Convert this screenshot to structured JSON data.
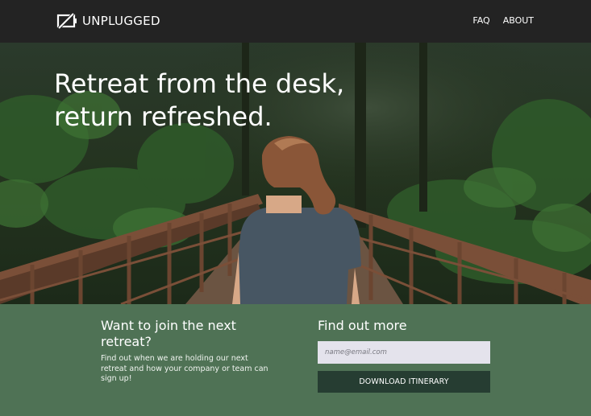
{
  "nav": {
    "logo_text": "UNPLUGGED",
    "links": [
      {
        "label": "FAQ"
      },
      {
        "label": "ABOUT"
      }
    ]
  },
  "hero": {
    "title_line1": "Retreat from the desk,",
    "title_line2": "return refreshed."
  },
  "signup": {
    "heading": "Want to join the next retreat?",
    "description": "Find out when we are holding our next retreat and how your company or team can sign up!"
  },
  "find_out": {
    "heading": "Find out more",
    "email_placeholder": "name@email.com",
    "button_label": "DOWNLOAD ITINERARY"
  },
  "colors": {
    "nav_bg": "#232323",
    "cta_bg": "#4f7255",
    "button_bg": "#263d32",
    "input_bg": "#e4e3ec"
  }
}
